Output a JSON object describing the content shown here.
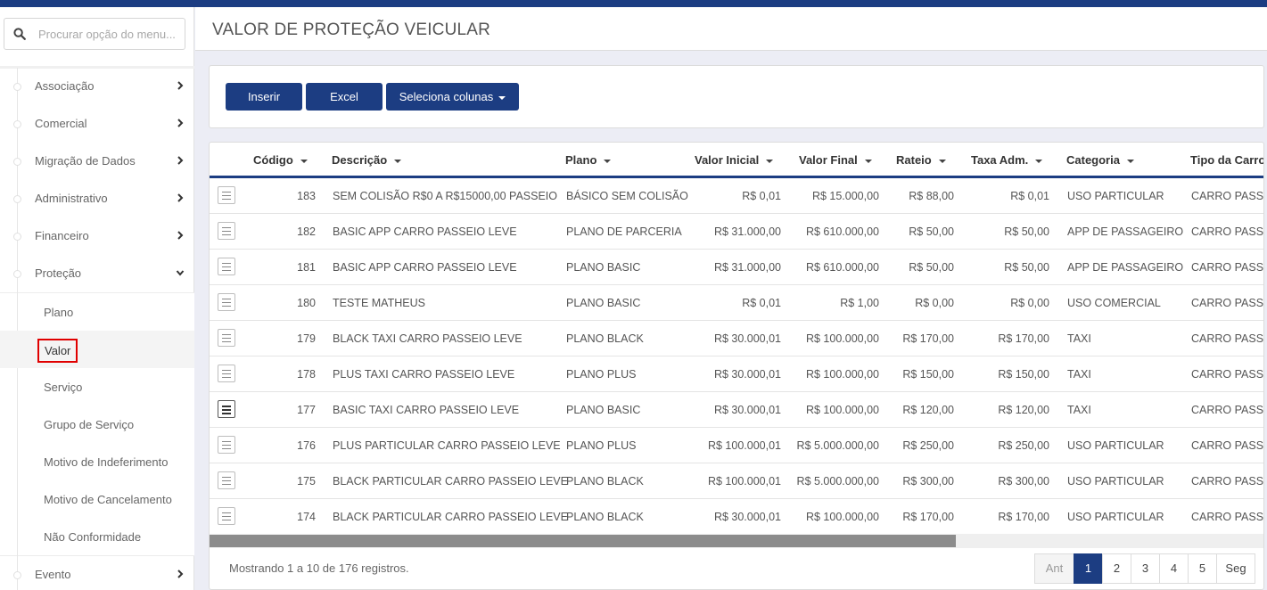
{
  "search": {
    "placeholder": "Procurar opção do menu..."
  },
  "menu": {
    "items": [
      {
        "label": "Associação",
        "expanded": false
      },
      {
        "label": "Comercial",
        "expanded": false
      },
      {
        "label": "Migração de Dados",
        "expanded": false
      },
      {
        "label": "Administrativo",
        "expanded": false
      },
      {
        "label": "Financeiro",
        "expanded": false
      },
      {
        "label": "Proteção",
        "expanded": true
      },
      {
        "label": "Evento",
        "expanded": false
      }
    ],
    "protecao_sub": [
      {
        "label": "Plano"
      },
      {
        "label": "Valor",
        "active": true
      },
      {
        "label": "Serviço"
      },
      {
        "label": "Grupo de Serviço"
      },
      {
        "label": "Motivo de Indeferimento"
      },
      {
        "label": "Motivo de Cancelamento"
      },
      {
        "label": "Não Conformidade"
      }
    ]
  },
  "page": {
    "title": "VALOR DE PROTEÇÃO VEICULAR"
  },
  "toolbar": {
    "insert_label": "Inserir",
    "excel_label": "Excel",
    "columns_label": "Seleciona colunas"
  },
  "table": {
    "headers": [
      "Código",
      "Descrição",
      "Plano",
      "Valor Inicial",
      "Valor Final",
      "Rateio",
      "Taxa Adm.",
      "Categoria",
      "Tipo da Carroc"
    ],
    "rows": [
      [
        "183",
        "SEM COLISÃO R$0 A R$15000,00 PASSEIO",
        "BÁSICO SEM COLISÃO",
        "R$ 0,01",
        "R$ 15.000,00",
        "R$ 88,00",
        "R$ 0,01",
        "USO PARTICULAR",
        "CARRO PASSE"
      ],
      [
        "182",
        "BASIC APP CARRO PASSEIO LEVE",
        "PLANO DE PARCERIA",
        "R$ 31.000,00",
        "R$ 610.000,00",
        "R$ 50,00",
        "R$ 50,00",
        "APP DE PASSAGEIRO",
        "CARRO PASSE"
      ],
      [
        "181",
        "BASIC APP CARRO PASSEIO LEVE",
        "PLANO BASIC",
        "R$ 31.000,00",
        "R$ 610.000,00",
        "R$ 50,00",
        "R$ 50,00",
        "APP DE PASSAGEIRO",
        "CARRO PASSE"
      ],
      [
        "180",
        "TESTE MATHEUS",
        "PLANO BASIC",
        "R$ 0,01",
        "R$ 1,00",
        "R$ 0,00",
        "R$ 0,00",
        "USO COMERCIAL",
        "CARRO PASSE"
      ],
      [
        "179",
        "BLACK TAXI CARRO PASSEIO LEVE",
        "PLANO BLACK",
        "R$ 30.000,01",
        "R$ 100.000,00",
        "R$ 170,00",
        "R$ 170,00",
        "TAXI",
        "CARRO PASSE"
      ],
      [
        "178",
        "PLUS TAXI CARRO PASSEIO LEVE",
        "PLANO PLUS",
        "R$ 30.000,01",
        "R$ 100.000,00",
        "R$ 150,00",
        "R$ 150,00",
        "TAXI",
        "CARRO PASSE"
      ],
      [
        "177",
        "BASIC TAXI CARRO PASSEIO LEVE",
        "PLANO BASIC",
        "R$ 30.000,01",
        "R$ 100.000,00",
        "R$ 120,00",
        "R$ 120,00",
        "TAXI",
        "CARRO PASSE"
      ],
      [
        "176",
        "PLUS PARTICULAR CARRO PASSEIO LEVE",
        "PLANO PLUS",
        "R$ 100.000,01",
        "R$ 5.000.000,00",
        "R$ 250,00",
        "R$ 250,00",
        "USO PARTICULAR",
        "CARRO PASSE"
      ],
      [
        "175",
        "BLACK PARTICULAR CARRO PASSEIO LEVE",
        "PLANO BLACK",
        "R$ 100.000,01",
        "R$ 5.000.000,00",
        "R$ 300,00",
        "R$ 300,00",
        "USO PARTICULAR",
        "CARRO PASSE"
      ],
      [
        "174",
        "BLACK PARTICULAR CARRO PASSEIO LEVE",
        "PLANO BLACK",
        "R$ 30.000,01",
        "R$ 100.000,00",
        "R$ 170,00",
        "R$ 170,00",
        "USO PARTICULAR",
        "CARRO PASSE"
      ]
    ]
  },
  "footer": {
    "info": "Mostrando 1 a 10 de 176 registros."
  },
  "pagination": {
    "prev": "Ant",
    "pages": [
      "1",
      "2",
      "3",
      "4",
      "5"
    ],
    "next": "Seg",
    "active": "1"
  },
  "colors": {
    "brand": "#1c3d82",
    "highlight": "#e00000"
  },
  "icons": {
    "search": "search-icon",
    "chevron_right": "chevron-right-icon",
    "chevron_down": "chevron-down-icon",
    "row_action": "list-lines-icon"
  }
}
